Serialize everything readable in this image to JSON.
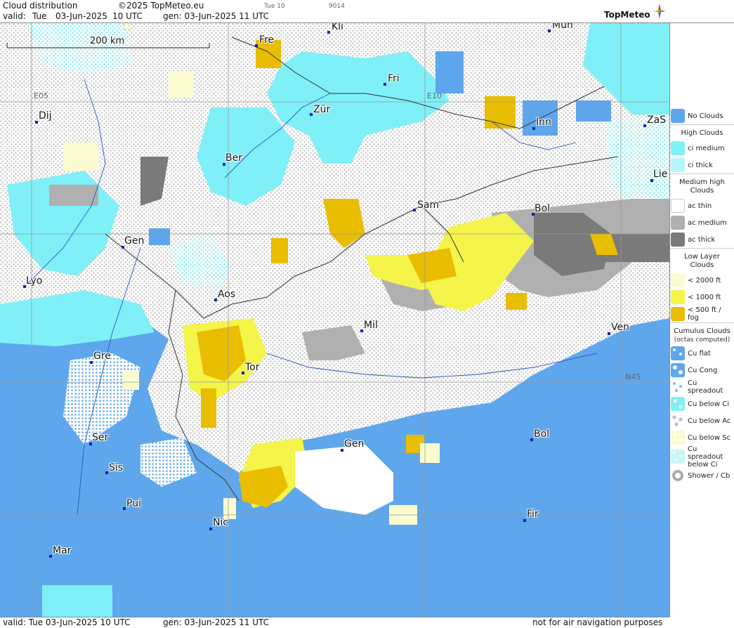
{
  "header": {
    "product": "Cloud distribution",
    "copyright": "©2025 TopMeteo.eu",
    "valid_label": "valid:",
    "valid_day": "Tue",
    "valid_date": "03-Jun-2025",
    "valid_time": "10 UTC",
    "gen": "gen: 03-Jun-2025 11 UTC",
    "small_tag": "Tue 10",
    "small_code": "9014",
    "brand": "TopMeteo"
  },
  "footer": {
    "valid": "valid:  Tue  03-Jun-2025  10 UTC",
    "gen": "gen: 03-Jun-2025 11 UTC",
    "disclaimer": "not for air navigation purposes"
  },
  "map": {
    "scale_label": "200 km",
    "grid_labels": [
      "E05",
      "E10",
      "N45"
    ],
    "cities": [
      "Fre",
      "Kli",
      "Mün",
      "Fri",
      "Dij",
      "Zür",
      "Inn",
      "ZaS",
      "Ber",
      "Lie",
      "Sam",
      "Bol",
      "Gen",
      "Lyo",
      "Aos",
      "Mil",
      "Ven",
      "Gre",
      "Tor",
      "Ser",
      "Gen",
      "Bol",
      "Sis",
      "Pui",
      "Nic",
      "Fir",
      "Mar"
    ],
    "colors": {
      "sea": "#5fa7ec",
      "ci_medium": "#7ff0f7",
      "no_clouds": "#5ea6ec",
      "ac_medium": "#b0b0b0",
      "ac_thick": "#7a7a7a",
      "low_2000": "#fbfbcf",
      "low_1000": "#f4f44a",
      "low_500": "#e9bd00"
    }
  },
  "legend": {
    "no_clouds": "No Clouds",
    "high_title": "High Clouds",
    "high": [
      "ci medium",
      "ci thick"
    ],
    "medium_title": "Medium high Clouds",
    "medium": [
      "ac thin",
      "ac medium",
      "ac thick"
    ],
    "low_title": "Low Layer Clouds",
    "low": [
      "< 2000 ft",
      "< 1000 ft",
      "< 500 ft / fog"
    ],
    "cumulus_title": "Cumulus Clouds",
    "cumulus_sub": "(octas computed)",
    "cumulus": [
      "Cu flat",
      "Cu Cong",
      "Cu spreadout",
      "Cu below Ci",
      "Cu below Ac",
      "Cu below Sc",
      "Cu spreadout below Ci",
      "Shower / Cb"
    ]
  }
}
